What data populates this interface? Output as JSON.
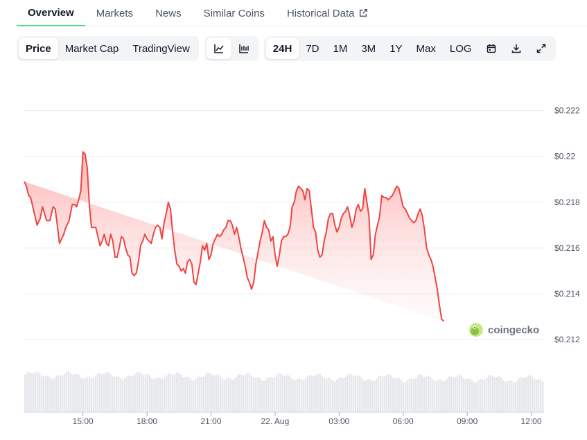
{
  "tabs": [
    {
      "label": "Overview",
      "active": true
    },
    {
      "label": "Markets",
      "active": false
    },
    {
      "label": "News",
      "active": false
    },
    {
      "label": "Similar Coins",
      "active": false
    },
    {
      "label": "Historical Data",
      "active": false
    }
  ],
  "toolbar": {
    "chart_kinds": [
      "Price",
      "Market Cap",
      "TradingView"
    ],
    "selected_kind": "Price",
    "ranges": [
      "24H",
      "7D",
      "1M",
      "3M",
      "1Y",
      "Max",
      "LOG"
    ],
    "selected_range": "24H",
    "icons": [
      "line-chart-icon",
      "candlestick-icon",
      "calendar-icon",
      "download-icon",
      "fullscreen-icon"
    ]
  },
  "watermark": {
    "text": "coingecko"
  },
  "colors": {
    "line": "#ef4444",
    "fill": "#fecaca",
    "accent": "#4ade80",
    "volume": "#e5e7eb"
  },
  "chart_data": {
    "type": "area",
    "y_tick_labels": [
      "$0.222",
      "$0.22",
      "$0.218",
      "$0.216",
      "$0.214",
      "$0.212"
    ],
    "y_ticks": [
      0.222,
      0.22,
      0.218,
      0.216,
      0.214,
      0.212
    ],
    "ylim": [
      0.2117,
      0.2232
    ],
    "x_tick_labels": [
      "15:00",
      "18:00",
      "21:00",
      "22. Aug",
      "03:00",
      "06:00",
      "09:00",
      "12:00"
    ],
    "x_ticks": [
      3,
      6,
      9,
      12,
      15,
      18,
      21,
      24
    ],
    "xlim": [
      0.25,
      24.6
    ],
    "grid": true,
    "x": [
      0.25,
      0.35,
      0.45,
      0.55,
      0.7,
      0.85,
      1.0,
      1.1,
      1.2,
      1.3,
      1.45,
      1.6,
      1.7,
      1.8,
      1.9,
      2.0,
      2.1,
      2.2,
      2.35,
      2.5,
      2.6,
      2.7,
      2.8,
      2.9,
      3.0,
      3.1,
      3.2,
      3.3,
      3.4,
      3.5,
      3.6,
      3.7,
      3.8,
      3.9,
      4.0,
      4.1,
      4.2,
      4.3,
      4.4,
      4.5,
      4.6,
      4.7,
      4.8,
      4.9,
      5.0,
      5.1,
      5.2,
      5.3,
      5.4,
      5.5,
      5.6,
      5.7,
      5.8,
      5.9,
      6.0,
      6.1,
      6.2,
      6.3,
      6.4,
      6.5,
      6.6,
      6.7,
      6.8,
      6.9,
      7.0,
      7.1,
      7.2,
      7.3,
      7.4,
      7.5,
      7.6,
      7.7,
      7.8,
      7.9,
      8.0,
      8.1,
      8.2,
      8.3,
      8.4,
      8.5,
      8.6,
      8.7,
      8.8,
      8.9,
      9.0,
      9.1,
      9.2,
      9.3,
      9.4,
      9.5,
      9.6,
      9.7,
      9.8,
      9.9,
      10.0,
      10.1,
      10.2,
      10.3,
      10.4,
      10.5,
      10.6,
      10.7,
      10.8,
      10.9,
      11.0,
      11.1,
      11.2,
      11.3,
      11.4,
      11.5,
      11.6,
      11.7,
      11.8,
      11.9,
      12.0,
      12.1,
      12.2,
      12.3,
      12.4,
      12.5,
      12.6,
      12.7,
      12.8,
      12.9,
      13.0,
      13.1,
      13.2,
      13.3,
      13.4,
      13.5,
      13.6,
      13.7,
      13.8,
      13.9,
      14.0,
      14.1,
      14.2,
      14.3,
      14.4,
      14.5,
      14.6,
      14.7,
      14.8,
      14.9,
      15.0,
      15.1,
      15.2,
      15.3,
      15.4,
      15.5,
      15.6,
      15.7,
      15.8,
      15.9,
      16.0,
      16.1,
      16.2,
      16.3,
      16.4,
      16.5,
      16.6,
      16.7,
      16.8,
      16.9,
      17.0,
      17.1,
      17.2,
      17.3,
      17.4,
      17.5,
      17.6,
      17.7,
      17.8,
      17.9,
      18.0,
      18.1,
      18.2,
      18.3,
      18.4,
      18.5,
      18.6,
      18.7,
      18.8,
      18.9,
      19.0,
      19.1,
      19.2,
      19.3,
      19.4,
      19.5,
      19.6,
      19.7,
      19.8,
      19.9,
      20.0,
      20.1,
      20.2,
      20.3,
      20.4,
      20.5,
      20.6,
      20.7,
      20.8,
      20.9,
      21.0,
      21.1,
      21.2,
      21.3,
      21.4,
      21.5,
      21.6,
      21.7,
      21.8,
      21.9,
      22.0,
      22.1,
      22.2,
      22.3,
      22.4,
      22.5,
      22.6,
      22.7,
      22.8,
      22.9,
      23.0,
      23.1,
      23.2,
      23.3,
      23.4,
      23.5,
      23.6,
      23.7,
      23.8,
      23.9,
      24.0,
      24.1,
      24.2,
      24.3,
      24.4,
      24.5,
      24.6
    ],
    "values": [
      0.2189,
      0.2187,
      0.2183,
      0.2182,
      0.2176,
      0.217,
      0.2173,
      0.2178,
      0.2175,
      0.2172,
      0.2172,
      0.2178,
      0.2177,
      0.217,
      0.2162,
      0.2164,
      0.2166,
      0.2169,
      0.2172,
      0.2179,
      0.2179,
      0.2178,
      0.2181,
      0.2185,
      0.2202,
      0.2201,
      0.2195,
      0.2179,
      0.2169,
      0.2169,
      0.2169,
      0.2165,
      0.2161,
      0.2163,
      0.2166,
      0.2162,
      0.2161,
      0.2166,
      0.2163,
      0.2156,
      0.2156,
      0.216,
      0.2165,
      0.2164,
      0.216,
      0.2157,
      0.2156,
      0.2149,
      0.2148,
      0.2149,
      0.2154,
      0.2161,
      0.2163,
      0.2166,
      0.2164,
      0.2163,
      0.2162,
      0.2166,
      0.2169,
      0.217,
      0.2169,
      0.2164,
      0.2171,
      0.2175,
      0.218,
      0.2177,
      0.2167,
      0.2159,
      0.2153,
      0.2152,
      0.215,
      0.2151,
      0.2149,
      0.2154,
      0.2155,
      0.2153,
      0.2145,
      0.2144,
      0.2149,
      0.2154,
      0.2161,
      0.2159,
      0.2162,
      0.2155,
      0.2157,
      0.2162,
      0.2164,
      0.2166,
      0.2165,
      0.2166,
      0.2168,
      0.2169,
      0.2172,
      0.2172,
      0.217,
      0.2166,
      0.2169,
      0.2165,
      0.216,
      0.2156,
      0.2152,
      0.2147,
      0.2145,
      0.2142,
      0.2145,
      0.2153,
      0.2158,
      0.2163,
      0.2167,
      0.2172,
      0.2169,
      0.2168,
      0.2163,
      0.2165,
      0.2157,
      0.2152,
      0.2157,
      0.2163,
      0.2165,
      0.2165,
      0.2166,
      0.2169,
      0.2178,
      0.218,
      0.2185,
      0.2187,
      0.2186,
      0.2185,
      0.2181,
      0.2186,
      0.2185,
      0.2177,
      0.2169,
      0.2167,
      0.2159,
      0.2156,
      0.2157,
      0.2163,
      0.2167,
      0.2173,
      0.2175,
      0.2175,
      0.217,
      0.2167,
      0.2169,
      0.2173,
      0.2175,
      0.2176,
      0.2178,
      0.2174,
      0.2169,
      0.2172,
      0.2177,
      0.2179,
      0.2176,
      0.2177,
      0.2186,
      0.218,
      0.2174,
      0.2155,
      0.2157,
      0.2166,
      0.217,
      0.2174,
      0.2183,
      0.2182,
      0.2182,
      0.2181,
      0.2182,
      0.2183,
      0.2185,
      0.2187,
      0.2186,
      0.2182,
      0.2178,
      0.2177,
      0.2175,
      0.2173,
      0.2172,
      0.2171,
      0.2172,
      0.2175,
      0.2177,
      0.2174,
      0.2168,
      0.216,
      0.2157,
      0.2155,
      0.2152,
      0.2147,
      0.2142,
      0.2135,
      0.2129,
      0.2128
    ]
  }
}
